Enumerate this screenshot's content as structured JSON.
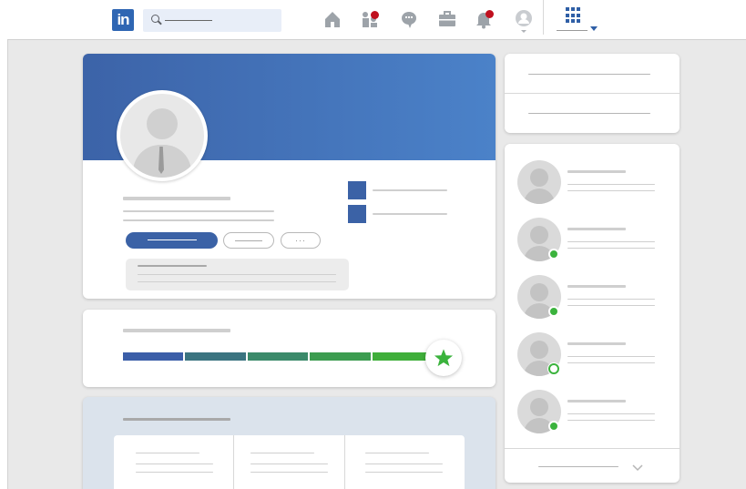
{
  "nav": {
    "logo_text": "in",
    "icons": [
      "home-icon",
      "my-network-icon",
      "messaging-icon",
      "jobs-icon",
      "notifications-icon",
      "me-avatar-icon",
      "work-grid-icon"
    ]
  },
  "colors": {
    "brand_blue": "#2f66b3",
    "banner_start": "#3c63a8",
    "banner_end": "#4b82c9",
    "badge_red": "#c0101e",
    "online_green": "#3bb33d",
    "star_green": "#3bb33d"
  },
  "strength_meter": {
    "segments": 5,
    "filled": 5,
    "segment_colors": [
      "#3b5ea8",
      "#3b7480",
      "#3b8a6a",
      "#3c9c50",
      "#3fae3a"
    ]
  },
  "people": [
    {
      "status": "none"
    },
    {
      "status": "online"
    },
    {
      "status": "online"
    },
    {
      "status": "mobile"
    },
    {
      "status": "online"
    }
  ]
}
